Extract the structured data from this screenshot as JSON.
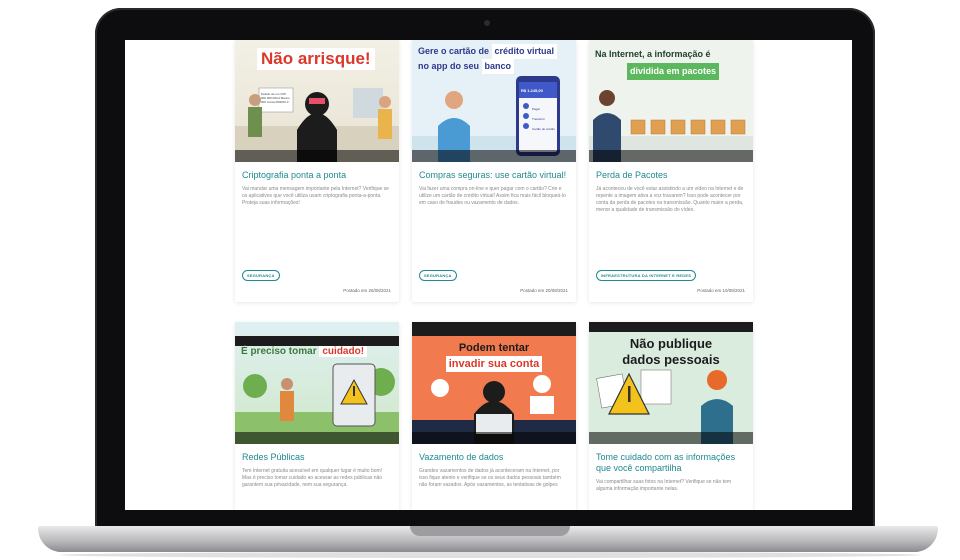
{
  "cards": [
    {
      "thumb_line1": "Não arrisque!",
      "title": "Criptografia ponta a ponta",
      "desc": "Vai mandar uma mensagem importante pela Internet? Verifique se os aplicativos que você utiliza usam criptografia ponta-a-ponta. Proteja suas informações!",
      "tag": "SEGURANÇA",
      "posted": "Postado em 26/08/2021",
      "thumb_note": "Pedido de um CPF 000.000.000-0 Banco 000 Conta 000000-0"
    },
    {
      "thumb_line1a": "Gere o cartão de",
      "thumb_line1b": "crédito virtual",
      "thumb_line2a": "no app do seu",
      "thumb_line2b": "banco",
      "title": "Compras seguras: use cartão virtual!",
      "desc": "Vai fazer uma compra on-line e quer pagar com o cartão? Crie e utilize um cartão de crédito virtual! Assim fica mais fácil bloqueá-lo em caso de fraudes ou vazamento de dados.",
      "tag": "SEGURANÇA",
      "posted": "Postado em 20/08/2021",
      "phone_amount": "R$ 1.245,00",
      "phone_items": [
        "Pagar",
        "Transferir",
        "Cartão de crédito"
      ]
    },
    {
      "thumb_line1": "Na Internet, a informação é",
      "thumb_line2": "dividida em pacotes",
      "title": "Perda de Pacotes",
      "desc": "Já aconteceu de você estar assistindo a um vídeo na Internet e de repente a imagem ativa a voz travarem? Isso pode acontecer por conta da perda de pacotes na transmissão. Quanto maior a perda, menor a qualidade de transmissão do vídeo.",
      "tag": "INFRAESTRUTURA DA INTERNET E REDES",
      "posted": "Postado em 10/08/2021"
    },
    {
      "thumb_line1a": "É preciso tomar",
      "thumb_line1b": "cuidado!",
      "title": "Redes Públicas",
      "desc": "Tem Internet gratuita acessível em qualquer lugar é muito bom! Mas é preciso tomar cuidado ao acessar as redes públicas não garantem sua privacidade, nem sua segurança."
    },
    {
      "thumb_line1": "Podem tentar",
      "thumb_line2": "invadir sua conta",
      "title": "Vazamento de dados",
      "desc": "Grandes vazamentos de dados já aconteceram na Internet, por isso fique atento e verifique se os seus dados pessoais também não foram vazados. Após vazamentos, as tentativas de golpes"
    },
    {
      "thumb_line1": "Não publique",
      "thumb_line2": "dados pessoais",
      "title": "Tome cuidado com as informações que você compartilha",
      "desc": "Vai compartilhar suas fotos na Internet? Verifique se não tem alguma informação importante nelas."
    }
  ],
  "colors": {
    "accent": "#1f8a8f",
    "red": "#d9382b",
    "green": "#5cb85c",
    "orange": "#f17a4e"
  }
}
